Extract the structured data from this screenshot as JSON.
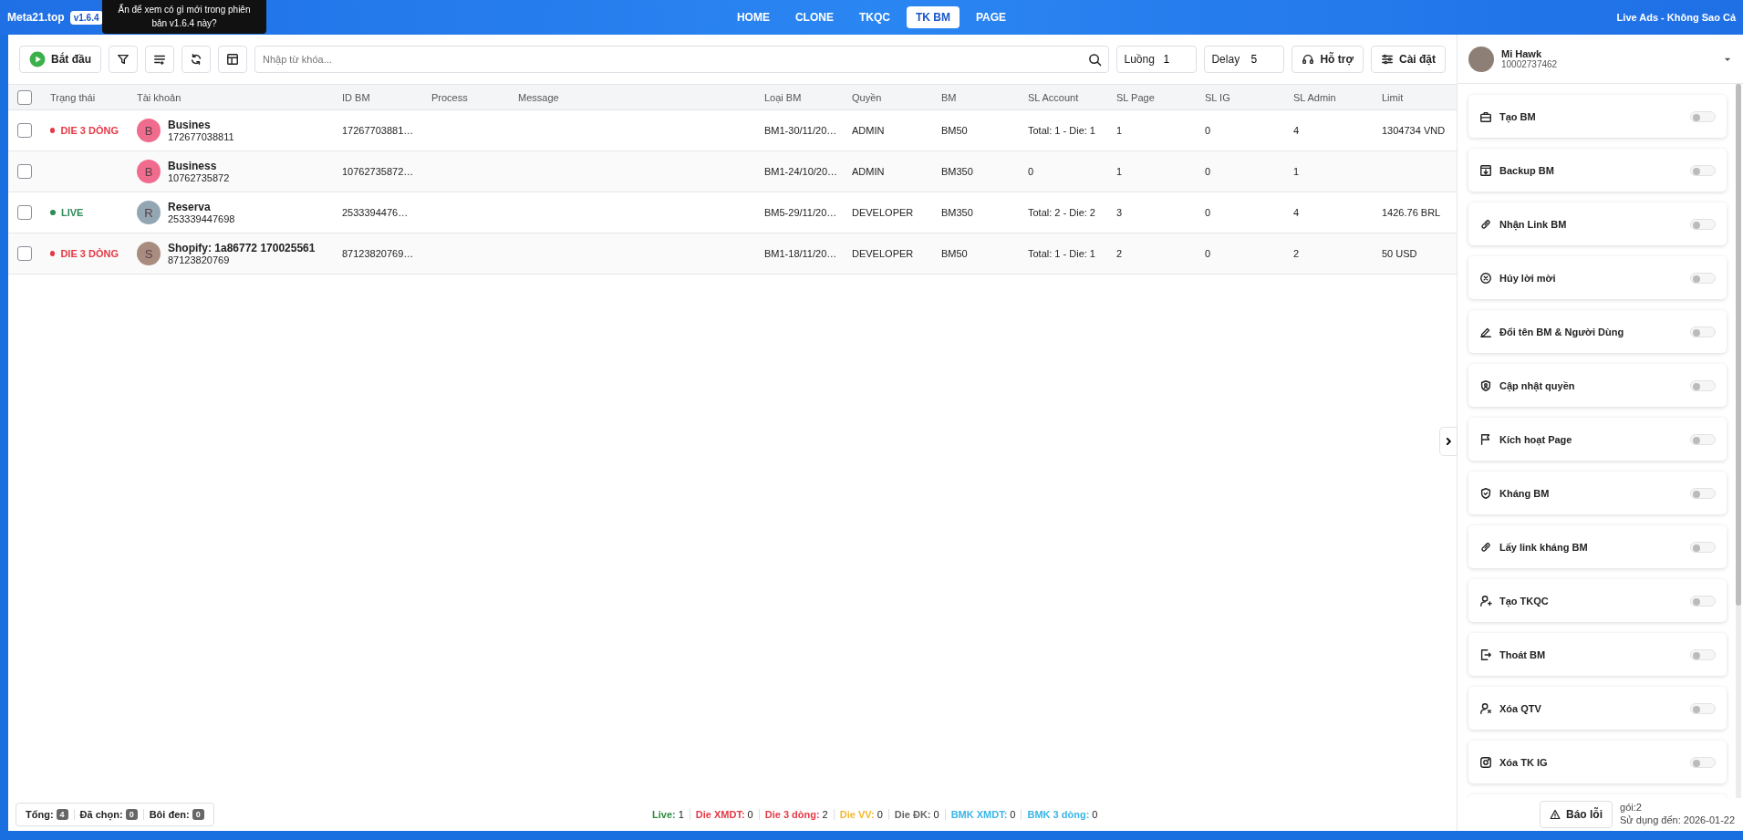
{
  "app": {
    "brand": "Meta21.top",
    "version": "v1.6.4",
    "tooltip": "Ấn để xem có gì mới trong phiên bản v1.6.4 này?",
    "account_name": "Live Ads - Không Sao Cả"
  },
  "nav_tabs": [
    {
      "label": "HOME",
      "selected": false
    },
    {
      "label": "CLONE",
      "selected": false
    },
    {
      "label": "TKQC",
      "selected": false
    },
    {
      "label": "TK BM",
      "selected": true
    },
    {
      "label": "PAGE",
      "selected": false
    }
  ],
  "toolbar": {
    "start_label": "Bắt đầu",
    "search": {
      "placeholder": "Nhập từ khóa..."
    },
    "threads": {
      "label": "Luồng",
      "value": "1"
    },
    "delay": {
      "label": "Delay",
      "value": "5"
    },
    "support_label": "Hỗ trợ",
    "settings_label": "Cài đặt"
  },
  "table": {
    "all_selected": false,
    "columns": [
      "Trạng thái",
      "Tài khoản",
      "ID BM",
      "Process",
      "Message",
      "Loại BM",
      "Quyền",
      "BM",
      "SL Account",
      "SL Page",
      "SL IG",
      "SL Admin",
      "Limit"
    ],
    "rows": [
      {
        "checked": false,
        "status": {
          "label": "DIE 3 DÒNG",
          "color": "#e53945"
        },
        "avatar": {
          "letter": "B",
          "color": "#f06c8e"
        },
        "name": "Busines",
        "account_id": "172677038811",
        "id_bm": "17267703881…",
        "bm_type": "BM1-30/11/20…",
        "role": "ADMIN",
        "bm": "BM50",
        "sl_account": "Total: 1 - Die: 1",
        "sl_page": "1",
        "sl_ig": "0",
        "sl_admin": "4",
        "limit": "1304734 VND"
      },
      {
        "checked": false,
        "avatar": {
          "letter": "B",
          "color": "#f06c8e"
        },
        "name": "Business",
        "account_id": "10762735872",
        "id_bm": "10762735872…",
        "bm_type": "BM1-24/10/20…",
        "role": "ADMIN",
        "bm": "BM350",
        "sl_account": "0",
        "sl_page": "1",
        "sl_ig": "0",
        "sl_admin": "1"
      },
      {
        "checked": false,
        "status": {
          "label": "LIVE",
          "color": "#2e8b57"
        },
        "avatar": {
          "letter": "R",
          "color": "#93a6b3"
        },
        "name": "Reserva",
        "account_id": "253339447698",
        "id_bm": "2533394476…",
        "bm_type": "BM5-29/11/20…",
        "role": "DEVELOPER",
        "bm": "BM350",
        "sl_account": "Total: 2 - Die: 2",
        "sl_page": "3",
        "sl_ig": "0",
        "sl_admin": "4",
        "limit": "1426.76 BRL"
      },
      {
        "checked": false,
        "status": {
          "label": "DIE 3 DÒNG",
          "color": "#e53945"
        },
        "avatar": {
          "letter": "S",
          "color": "#a98c80"
        },
        "name": "Shopify: 1a86772 170025561",
        "account_id": "87123820769",
        "id_bm": "87123820769…",
        "bm_type": "BM1-18/11/20…",
        "role": "DEVELOPER",
        "bm": "BM50",
        "sl_account": "Total: 1 - Die: 1",
        "sl_page": "2",
        "sl_ig": "0",
        "sl_admin": "2",
        "limit": "50 USD"
      }
    ]
  },
  "footer": {
    "counts": [
      {
        "label": "Tổng:",
        "value": "4"
      },
      {
        "label": "Đã chọn:",
        "value": "0"
      },
      {
        "label": "Bôi đen:",
        "value": "0"
      }
    ],
    "stats": [
      {
        "label": "Live:",
        "value": "1",
        "color": "#2e8b3e"
      },
      {
        "label": "Die XMDT:",
        "value": "0",
        "color": "#e53945"
      },
      {
        "label": "Die 3 dòng:",
        "value": "2",
        "color": "#e53945"
      },
      {
        "label": "Die VV:",
        "value": "0",
        "color": "#f5b82e"
      },
      {
        "label": "Die ĐK:",
        "value": "0",
        "color": "#666666"
      },
      {
        "label": "BMK XMDT:",
        "value": "0",
        "color": "#3ab5e6"
      },
      {
        "label": "BMK 3 dòng:",
        "value": "0",
        "color": "#3ab5e6"
      }
    ]
  },
  "profile": {
    "name": "Mi Hawk",
    "id": "10002737462"
  },
  "options": [
    {
      "kind": "briefcase",
      "label": "Tạo BM",
      "on": false
    },
    {
      "kind": "backup",
      "label": "Backup BM",
      "on": false
    },
    {
      "kind": "link",
      "label": "Nhận Link BM",
      "on": false
    },
    {
      "kind": "cancel",
      "label": "Hủy lời mời",
      "on": false
    },
    {
      "kind": "pen",
      "label": "Đổi tên BM & Người Dùng",
      "on": false
    },
    {
      "kind": "badge",
      "label": "Cập nhật quyền",
      "on": false
    },
    {
      "kind": "flag",
      "label": "Kích hoạt Page",
      "on": false
    },
    {
      "kind": "shield",
      "label": "Kháng BM",
      "on": false
    },
    {
      "kind": "link",
      "label": "Lấy link kháng BM",
      "on": false
    },
    {
      "kind": "user-add",
      "label": "Tạo TKQC",
      "on": false
    },
    {
      "kind": "exit",
      "label": "Thoát BM",
      "on": false
    },
    {
      "kind": "user-remove",
      "label": "Xóa QTV",
      "on": false
    },
    {
      "kind": "instagram",
      "label": "Xóa TK IG",
      "on": false
    }
  ],
  "side_footer": {
    "report_label": "Báo lỗi",
    "plan": "gói:2",
    "expiry": "Sử dụng đến: 2026-01-22"
  }
}
